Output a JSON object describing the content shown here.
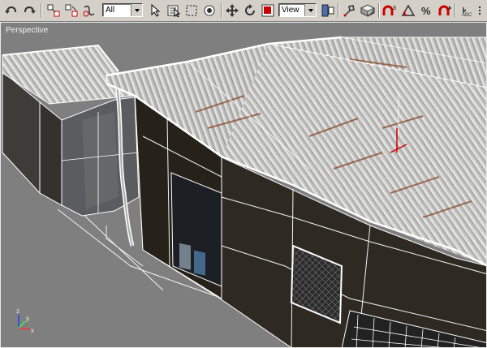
{
  "toolbar": {
    "selection_filter": "All",
    "coord_system": "View",
    "tools": [
      {
        "name": "undo-icon"
      },
      {
        "name": "redo-icon"
      },
      {
        "name": "select-and-link-icon"
      },
      {
        "name": "unlink-selection-icon"
      },
      {
        "name": "bind-to-space-warp-icon"
      },
      {
        "name": "select-object-icon"
      },
      {
        "name": "select-by-name-icon"
      },
      {
        "name": "rectangular-selection-icon"
      },
      {
        "name": "window-crossing-icon"
      },
      {
        "name": "select-and-move-icon"
      },
      {
        "name": "select-and-rotate-icon"
      },
      {
        "name": "select-and-scale-icon"
      },
      {
        "name": "use-pivot-center-icon"
      },
      {
        "name": "select-and-manipulate-icon"
      },
      {
        "name": "keyboard-shortcut-icon"
      },
      {
        "name": "snaps-toggle-icon"
      },
      {
        "name": "angle-snap-icon"
      },
      {
        "name": "percent-snap-icon"
      },
      {
        "name": "spinner-snap-icon"
      },
      {
        "name": "named-selection-icon"
      }
    ]
  },
  "viewport": {
    "label": "Perspective",
    "axis_labels": {
      "x": "x",
      "y": "y",
      "z": "z"
    }
  },
  "colors": {
    "viewport_bg": "#7f7f7f",
    "wire": "#ffffff",
    "wall": "#2e2a22",
    "roof": "#bfbfbf",
    "rust": "#8a4a2a"
  }
}
